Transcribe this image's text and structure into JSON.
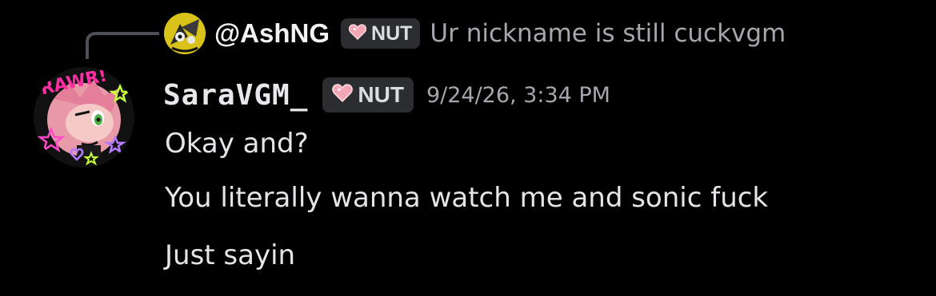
{
  "reply": {
    "username": "@AshNG",
    "tag": "NUT",
    "text": "Ur nickname is still cuckvgm"
  },
  "message": {
    "username": "SaraVGM_",
    "tag": "NUT",
    "timestamp": "9/24/26, 3:34 PM",
    "lines": [
      "Okay and?",
      "You literally wanna watch me and sonic fuck",
      "Just sayin"
    ]
  },
  "avatar": {
    "sticker_text": "RAWR!"
  },
  "colors": {
    "background": "#000000",
    "tag_bg": "#2b2d31",
    "heart": "#f4a6b4",
    "muted": "#a4a7ad"
  },
  "icons": [
    "reply-connector",
    "heart-icon",
    "avatar"
  ]
}
